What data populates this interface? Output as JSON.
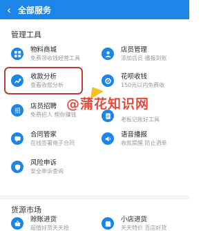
{
  "header": {
    "title": "全部服务"
  },
  "sections": {
    "management": "管理工具",
    "sourcing": "货源市场"
  },
  "items": {
    "goods_store": {
      "label": "物料商城",
      "desc": "免费领收钱经营工具"
    },
    "store_manage": {
      "label": "店员管理",
      "desc": "添加店员 播报到账"
    },
    "analysis": {
      "label": "收款分析",
      "desc": "查看收款分析"
    },
    "huabei": {
      "label": "花呗收钱",
      "desc": "150元以内免费收"
    },
    "recruit": {
      "label": "店员招聘",
      "desc": "免费招人 帮你赚钱"
    },
    "bookkeeping": {
      "label": "记账",
      "desc": "老板记账好工具"
    },
    "contract": {
      "label": "合同管家",
      "desc": "在线签署电子合同"
    },
    "voice": {
      "label": "语音播报",
      "desc": "收款提醒 防止洒单"
    },
    "risk": {
      "label": "风险申诉",
      "desc": "安全申诉查询"
    },
    "credit_buy": {
      "label": "赊账进货",
      "desc": "超值好货天天抢"
    },
    "shop_buy": {
      "label": "小店进货",
      "desc": "天天特价 百店好货"
    }
  },
  "watermark": "@蒲花知识网",
  "colors": {
    "brand_blue": "#1c85e8",
    "highlight_red": "#c23a2f",
    "watermark_red": "#e64a3b"
  }
}
